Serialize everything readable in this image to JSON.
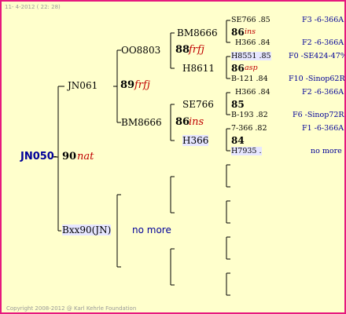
{
  "header": {
    "date": "11- 4-2012 ( 22: 28)"
  },
  "footer": {
    "copyright": "Copyright 2008-2012 @ Karl Kehrle Foundation"
  },
  "root": {
    "name": "JN050",
    "score": "90",
    "tag": "nat"
  },
  "gen1": {
    "sire": {
      "name": "JN061",
      "score": "89",
      "tag": "frfj"
    },
    "dam": {
      "name": "Bxx90(JN)",
      "note": "no more"
    }
  },
  "gen2": {
    "ss": {
      "name": "OO8803",
      "score": "88",
      "tag": "frfj"
    },
    "sd": {
      "name": "BM8666",
      "score": "86",
      "tag": "ins"
    }
  },
  "gen3": {
    "sss": {
      "name": "BM8666"
    },
    "ssd": {
      "name": "H8611"
    },
    "sds": {
      "name": "SE766"
    },
    "sdd": {
      "name": "H366"
    }
  },
  "gen4": [
    {
      "top": "SE766 .85",
      "top_code": "F3 -6-366A",
      "score": "86",
      "tag": "ins",
      "bottom": "H366 .84",
      "bottom_code": "F2 -6-366A"
    },
    {
      "top": "H8551 .85",
      "top_code": "F0 -SE424-47%",
      "score": "86",
      "tag": "asp",
      "bottom": "B-121 .84",
      "bottom_code": "F10 -Sinop62R"
    },
    {
      "top": "H366 .84",
      "top_code": "F2 -6-366A",
      "score": "85",
      "tag": "",
      "bottom": "B-193 .82",
      "bottom_code": "F6 -Sinop72R"
    },
    {
      "top": "7-366 .82",
      "top_code": "F1 -6-366A",
      "score": "84",
      "tag": "",
      "bottom": "H7935 .",
      "bottom_code": "no more"
    }
  ]
}
